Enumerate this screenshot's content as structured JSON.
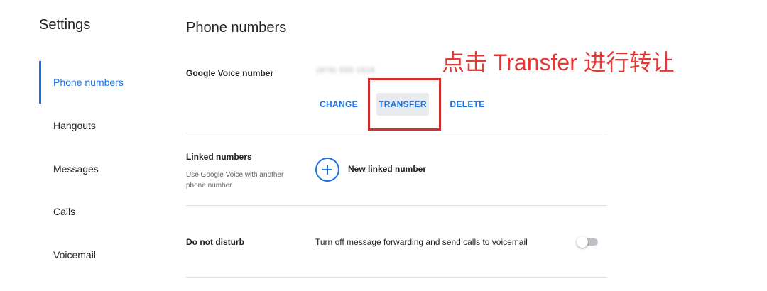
{
  "sidebar": {
    "title": "Settings",
    "items": [
      {
        "label": "Phone numbers",
        "active": true
      },
      {
        "label": "Hangouts",
        "active": false
      },
      {
        "label": "Messages",
        "active": false
      },
      {
        "label": "Calls",
        "active": false
      },
      {
        "label": "Voicemail",
        "active": false
      }
    ]
  },
  "main": {
    "title": "Phone numbers",
    "google_voice": {
      "label": "Google Voice number",
      "number_blurred": "(978) 555-1516",
      "buttons": {
        "change": "CHANGE",
        "transfer": "TRANSFER",
        "delete": "DELETE"
      }
    },
    "annotation": "点击 Transfer 进行转让",
    "linked": {
      "label": "Linked numbers",
      "sublabel": "Use Google Voice with another phone number",
      "add_label": "New linked number",
      "add_icon": "plus-icon"
    },
    "dnd": {
      "label": "Do not disturb",
      "description": "Turn off message forwarding and send calls to voicemail",
      "toggle_on": false
    }
  },
  "colors": {
    "accent": "#1a73e8",
    "annotation_red": "#e53935",
    "highlight_red": "#d32f2f"
  }
}
